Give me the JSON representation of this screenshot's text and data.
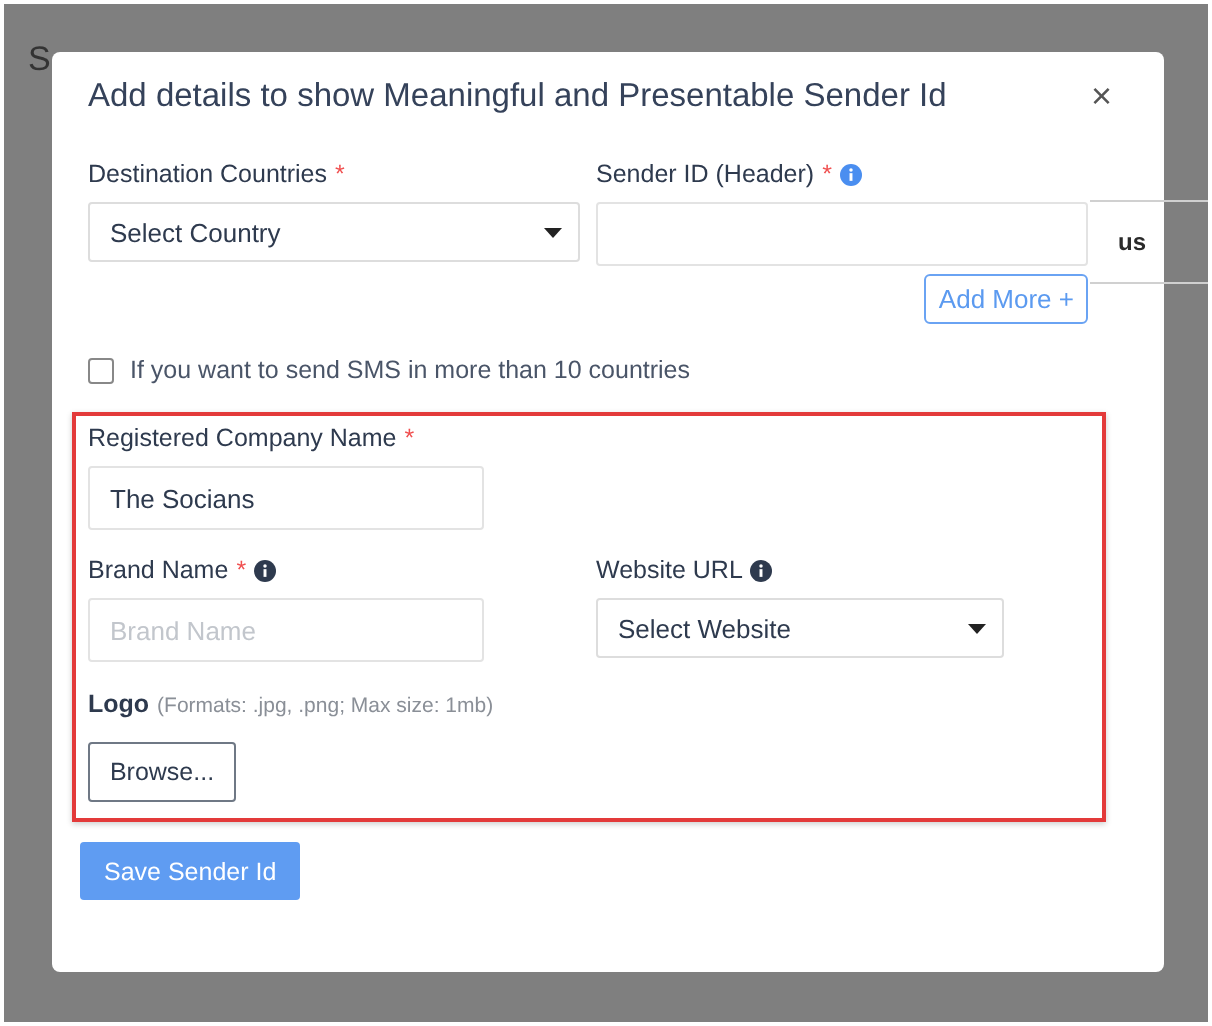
{
  "background": {
    "title": "S",
    "column_fragment": "us"
  },
  "dialog": {
    "title": "Add details to show Meaningful and Presentable Sender Id",
    "close": "×",
    "destination": {
      "label": "Destination Countries",
      "required": "*",
      "value": "Select Country"
    },
    "sender_id": {
      "label": "Sender ID (Header)",
      "required": "*"
    },
    "add_more": "Add More +",
    "multi_country": {
      "label": "If you want to send SMS in more than 10 countries",
      "checked": false
    },
    "company": {
      "label": "Registered Company Name",
      "required": "*",
      "value": "The Socians"
    },
    "brand": {
      "label": "Brand Name",
      "required": "*",
      "placeholder": "Brand Name"
    },
    "website": {
      "label": "Website URL",
      "value": "Select Website"
    },
    "logo": {
      "label": "Logo",
      "hint": "(Formats: .jpg, .png; Max size: 1mb)",
      "button": "Browse..."
    },
    "save": "Save Sender Id"
  }
}
